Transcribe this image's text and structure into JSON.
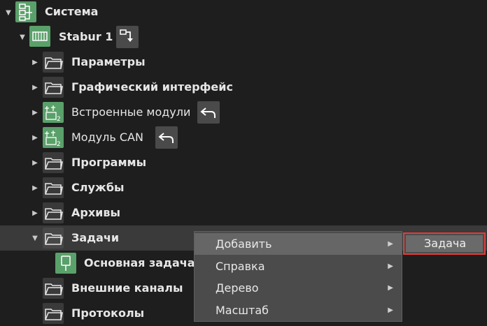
{
  "tree": {
    "system": {
      "label": "Система"
    },
    "stabur": {
      "label": "Stabur 1"
    },
    "items": [
      {
        "label": "Параметры"
      },
      {
        "label": "Графический интерфейс"
      },
      {
        "label": "Встроенные модули"
      },
      {
        "label": "Модуль CAN"
      },
      {
        "label": "Программы"
      },
      {
        "label": "Службы"
      },
      {
        "label": "Архивы"
      },
      {
        "label": "Задачи"
      },
      {
        "label": "Основная задача"
      },
      {
        "label": "Внешние каналы"
      },
      {
        "label": "Протоколы"
      }
    ]
  },
  "context_menu": {
    "items": [
      {
        "label": "Добавить",
        "arrow": "▶"
      },
      {
        "label": "Справка",
        "arrow": "▶"
      },
      {
        "label": "Дерево",
        "arrow": "▶"
      },
      {
        "label": "Масштаб",
        "arrow": "▶"
      }
    ]
  },
  "submenu": {
    "items": [
      {
        "label": "Задача"
      }
    ]
  },
  "colors": {
    "background": "#1e1e1e",
    "selected_row": "#3a3a3a",
    "menu": "#4b4b4b",
    "highlight_border": "#e23c3c",
    "green_icon": "#5aa06a"
  }
}
